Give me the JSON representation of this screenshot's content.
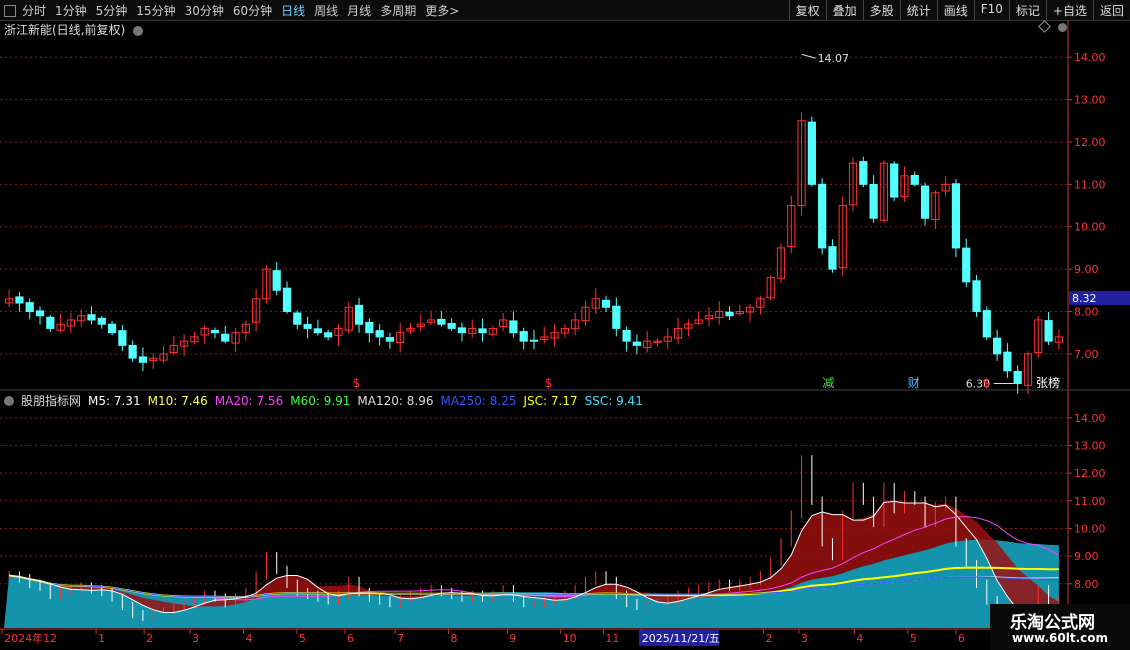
{
  "toolbar": {
    "periods": [
      "分时",
      "1分钟",
      "5分钟",
      "15分钟",
      "30分钟",
      "60分钟",
      "日线",
      "周线",
      "月线",
      "多周期",
      "更多>"
    ],
    "active_period": "日线",
    "buttons": [
      "复权",
      "叠加",
      "多股",
      "统计",
      "画线",
      "F10",
      "标记",
      "+自选",
      "返回"
    ]
  },
  "stock": {
    "title": "浙江新能(日线,前复权)"
  },
  "indicator": {
    "name": "股朋指标网",
    "values": [
      {
        "label": "M5: 7.31",
        "color": "#ffffff"
      },
      {
        "label": "M10: 7.46",
        "color": "#ffff40"
      },
      {
        "label": "MA20: 7.56",
        "color": "#ff40ff"
      },
      {
        "label": "M60: 9.91",
        "color": "#40ff40"
      },
      {
        "label": "MA120: 8.96",
        "color": "#dddddd"
      },
      {
        "label": "MA250: 8.25",
        "color": "#3355ff"
      },
      {
        "label": "JSC: 7.17",
        "color": "#ffff00"
      },
      {
        "label": "SSC: 9.41",
        "color": "#40e0ff"
      }
    ]
  },
  "watermark": {
    "title": "乐淘公式网",
    "url": "www.60lt.com"
  },
  "colors": {
    "up": "#ff3232",
    "down": "#54ffff",
    "axis": "#c0392b",
    "grid": "#8b1a1a",
    "highlight": "#2020a0"
  },
  "chart_data": {
    "type": "candlestick",
    "y_axis_main": {
      "ticks": [
        7.0,
        8.0,
        9.0,
        10.0,
        11.0,
        12.0,
        13.0,
        14.0
      ],
      "range": [
        6.1,
        14.5
      ]
    },
    "y_axis_indicator": {
      "ticks": [
        8.0,
        9.0,
        10.0,
        11.0,
        12.0,
        13.0,
        14.0
      ],
      "range": [
        6.4,
        14.5
      ]
    },
    "x_axis_labels": [
      "2024年12",
      "1",
      "2",
      "3",
      "4",
      "5",
      "6",
      "7",
      "8",
      "9",
      "10",
      "11",
      "2025/11/21/五",
      "2",
      "3",
      "4",
      "5",
      "6"
    ],
    "current_price": 8.32,
    "annotations": {
      "high": {
        "label": "14.07",
        "value": 14.07
      },
      "low": {
        "label": "6.30",
        "value": 6.3
      }
    },
    "markers": [
      {
        "label": "$",
        "color": "#ff3232"
      },
      {
        "label": "$",
        "color": "#ff3232"
      },
      {
        "label": "减",
        "color": "#40e040"
      },
      {
        "label": "财",
        "color": "#40c0ff"
      },
      {
        "label": "$",
        "color": "#ff3232"
      },
      {
        "label": "张榜",
        "color": "#ffffff"
      }
    ],
    "closes": [
      8.3,
      8.2,
      8.0,
      7.9,
      7.6,
      7.7,
      7.8,
      7.9,
      7.8,
      7.7,
      7.5,
      7.2,
      6.9,
      6.8,
      6.9,
      7.0,
      7.2,
      7.3,
      7.4,
      7.6,
      7.5,
      7.3,
      7.5,
      7.7,
      8.3,
      9.0,
      8.5,
      8.0,
      7.7,
      7.6,
      7.5,
      7.4,
      7.6,
      8.1,
      7.7,
      7.5,
      7.4,
      7.3,
      7.5,
      7.6,
      7.7,
      7.8,
      7.7,
      7.6,
      7.5,
      7.6,
      7.5,
      7.6,
      7.8,
      7.5,
      7.3,
      7.3,
      7.4,
      7.5,
      7.6,
      7.8,
      8.1,
      8.3,
      8.1,
      7.6,
      7.3,
      7.2,
      7.3,
      7.3,
      7.4,
      7.6,
      7.7,
      7.8,
      7.9,
      8.0,
      7.9,
      8.0,
      8.1,
      8.3,
      8.8,
      9.5,
      10.5,
      12.5,
      11.0,
      9.5,
      9.0,
      10.5,
      11.5,
      11.0,
      10.2,
      11.5,
      10.7,
      11.2,
      11.0,
      10.2,
      10.8,
      11.0,
      9.5,
      8.7,
      8.0,
      7.4,
      7.0,
      6.6,
      6.3,
      7.0,
      7.8,
      7.3,
      7.4
    ]
  }
}
